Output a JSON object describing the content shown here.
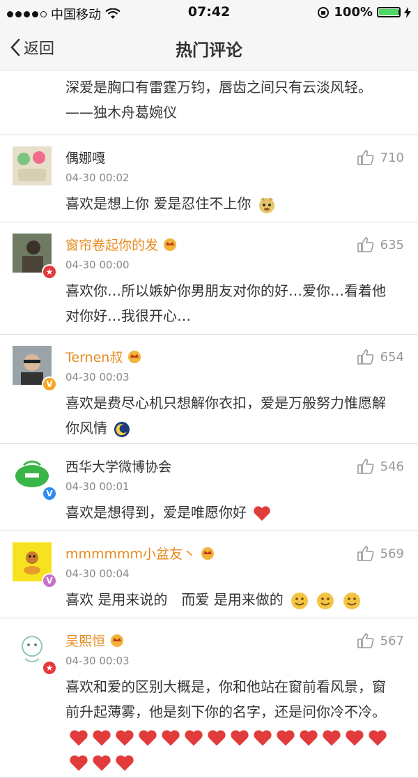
{
  "status": {
    "carrier": "中国移动",
    "time": "07:42",
    "battery": "100%"
  },
  "nav": {
    "back_label": "返回",
    "title": "热门评论"
  },
  "partial_text": "深爱是胸口有雷霆万钧，唇齿之间只有云淡风轻。——独木舟葛婉仪",
  "comments": [
    {
      "name": "偶娜嘎",
      "time": "04-30 00:02",
      "likes": "710",
      "text": "喜欢是想上你 爱是忍住不上你"
    },
    {
      "name": "窗帘卷起你的发",
      "time": "04-30 00:00",
      "likes": "635",
      "text": "喜欢你…所以嫉妒你男朋友对你的好…爱你…看着他对你好…我很开心…"
    },
    {
      "name": "Ternen叔",
      "time": "04-30 00:03",
      "likes": "654",
      "text": "喜欢是费尽心机只想解你衣扣，爱是万般努力惟愿解你风情"
    },
    {
      "name": "西华大学微博协会",
      "time": "04-30 00:01",
      "likes": "546",
      "text": "喜欢是想得到，爱是唯愿你好"
    },
    {
      "name": "mmmmmm小盆友丶",
      "time": "04-30 00:04",
      "likes": "569",
      "text": "喜欢 是用来说的　而爱 是用来做的"
    },
    {
      "name": "吴熙恒",
      "time": "04-30 00:03",
      "likes": "567",
      "text": "喜欢和爱的区别大概是，你和他站在窗前看风景，窗前升起薄雾，他是刻下你的名字，还是问你冷不冷。"
    }
  ],
  "icons": {
    "back": "chevron-left-icon",
    "like": "thumbs-up-icon",
    "crown": "crown-icon",
    "heart": "heart-icon",
    "smile": "smile-icon"
  },
  "colors": {
    "vip_name": "#e68a1e",
    "heart": "#e23b3b",
    "battery": "#4cd964"
  }
}
